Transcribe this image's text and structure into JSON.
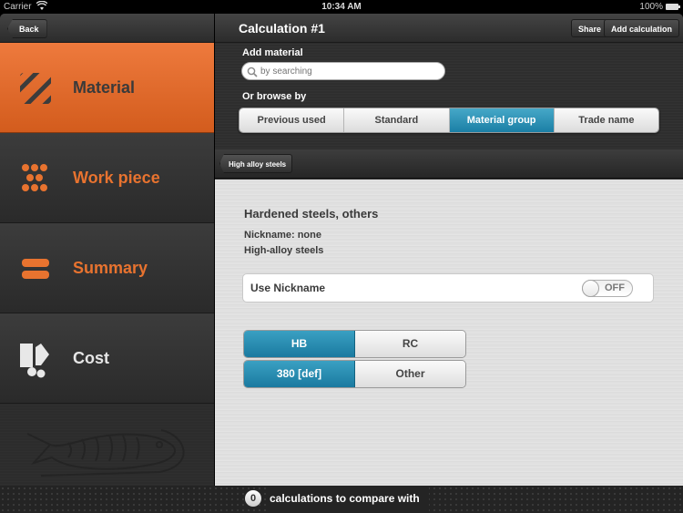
{
  "status_bar": {
    "carrier": "Carrier",
    "time": "10:34 AM",
    "battery": "100%"
  },
  "sidebar": {
    "back_label": "Back",
    "items": [
      {
        "label": "Material",
        "icon": "hatched-square-icon",
        "active": true
      },
      {
        "label": "Work piece",
        "icon": "dots-grid-icon",
        "active": false
      },
      {
        "label": "Summary",
        "icon": "two-bars-icon",
        "active": false
      },
      {
        "label": "Cost",
        "icon": "cost-icon",
        "active": false
      }
    ]
  },
  "header": {
    "title": "Calculation #1",
    "share_label": "Share",
    "add_calculation_label": "Add calculation"
  },
  "material_search": {
    "add_material_label": "Add material",
    "search_placeholder": "by searching",
    "browse_label": "Or browse by",
    "browse_options": [
      "Previous used",
      "Standard",
      "Material group",
      "Trade name"
    ],
    "browse_selected": "Material group"
  },
  "breadcrumb": {
    "back_label": "High alloy steels"
  },
  "detail": {
    "title": "Hardened steels, others",
    "nickname_line": "Nickname: none",
    "group_line": "High-alloy steels",
    "use_nickname_label": "Use Nickname",
    "use_nickname_toggle": "OFF",
    "hardness_units": [
      "HB",
      "RC"
    ],
    "hardness_unit_selected": "HB",
    "hardness_values": [
      "380  [def]",
      "Other"
    ],
    "hardness_value_selected": "380  [def]"
  },
  "bottom_bar": {
    "compare_count": "0",
    "compare_text": "calculations to compare with"
  },
  "colors": {
    "accent_orange": "#e8732f",
    "selected_blue": "#2a8fb5"
  }
}
